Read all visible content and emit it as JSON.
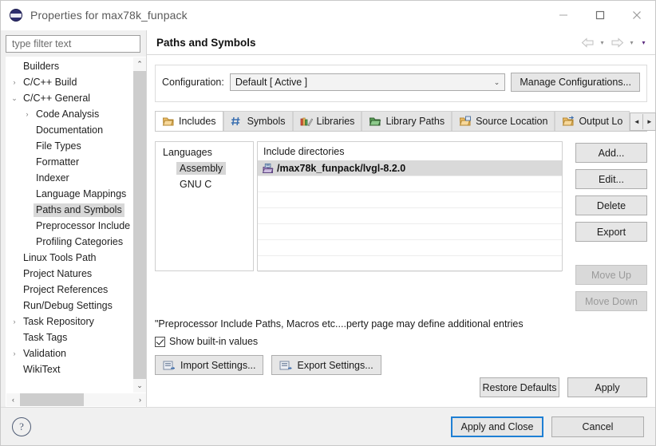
{
  "window": {
    "title": "Properties for max78k_funpack",
    "icon": "eclipse-ball-icon",
    "minimize": "—",
    "maximize": "□",
    "close": "✕"
  },
  "sidebar": {
    "filter": {
      "placeholder": "type filter text",
      "value": ""
    },
    "items": [
      {
        "label": "Builders",
        "level": 0,
        "twisty": "",
        "selected": false
      },
      {
        "label": "C/C++ Build",
        "level": 0,
        "twisty": "›",
        "selected": false
      },
      {
        "label": "C/C++ General",
        "level": 0,
        "twisty": "⌄",
        "selected": false
      },
      {
        "label": "Code Analysis",
        "level": 1,
        "twisty": "›",
        "selected": false
      },
      {
        "label": "Documentation",
        "level": 1,
        "twisty": "",
        "selected": false
      },
      {
        "label": "File Types",
        "level": 1,
        "twisty": "",
        "selected": false
      },
      {
        "label": "Formatter",
        "level": 1,
        "twisty": "",
        "selected": false
      },
      {
        "label": "Indexer",
        "level": 1,
        "twisty": "",
        "selected": false
      },
      {
        "label": "Language Mappings",
        "level": 1,
        "twisty": "",
        "selected": false
      },
      {
        "label": "Paths and Symbols",
        "level": 1,
        "twisty": "",
        "selected": true
      },
      {
        "label": "Preprocessor Include",
        "level": 1,
        "twisty": "",
        "selected": false
      },
      {
        "label": "Profiling Categories",
        "level": 1,
        "twisty": "",
        "selected": false
      },
      {
        "label": "Linux Tools Path",
        "level": 0,
        "twisty": "",
        "selected": false
      },
      {
        "label": "Project Natures",
        "level": 0,
        "twisty": "",
        "selected": false
      },
      {
        "label": "Project References",
        "level": 0,
        "twisty": "",
        "selected": false
      },
      {
        "label": "Run/Debug Settings",
        "level": 0,
        "twisty": "",
        "selected": false
      },
      {
        "label": "Task Repository",
        "level": 0,
        "twisty": "›",
        "selected": false
      },
      {
        "label": "Task Tags",
        "level": 0,
        "twisty": "",
        "selected": false
      },
      {
        "label": "Validation",
        "level": 0,
        "twisty": "›",
        "selected": false
      },
      {
        "label": "WikiText",
        "level": 0,
        "twisty": "",
        "selected": false
      }
    ],
    "scroll_up": "⌃",
    "scroll_down": "⌄",
    "scroll_left": "‹",
    "scroll_right": "›"
  },
  "page": {
    "title": "Paths and Symbols",
    "nav": {
      "back": "back-arrow",
      "forward": "forward-arrow",
      "caret": "▾"
    },
    "configuration": {
      "label": "Configuration:",
      "value": "Default  [ Active ]",
      "caret": "⌄",
      "manage_button": "Manage Configurations..."
    },
    "tabs": [
      {
        "label": "Includes",
        "icon": "includes-icon",
        "selected": true
      },
      {
        "label": "Symbols",
        "icon": "hash-icon",
        "selected": false
      },
      {
        "label": "Libraries",
        "icon": "libraries-icon",
        "selected": false
      },
      {
        "label": "Library Paths",
        "icon": "library-paths-icon",
        "selected": false
      },
      {
        "label": "Source Location",
        "icon": "source-location-icon",
        "selected": false
      },
      {
        "label": "Output Lo",
        "icon": "output-location-icon",
        "selected": false
      }
    ],
    "tab_scroll": {
      "left": "◄",
      "right": "►"
    },
    "languages": {
      "header": "Languages",
      "items": [
        {
          "label": "Assembly",
          "selected": true
        },
        {
          "label": "GNU C",
          "selected": false
        }
      ]
    },
    "include_directories": {
      "header": "Include directories",
      "rows": [
        {
          "path": "/max78k_funpack/lvgl-8.2.0",
          "icon": "include-folder-icon",
          "selected": true
        },
        {
          "path": "",
          "icon": "",
          "selected": false
        },
        {
          "path": "",
          "icon": "",
          "selected": false
        },
        {
          "path": "",
          "icon": "",
          "selected": false
        },
        {
          "path": "",
          "icon": "",
          "selected": false
        },
        {
          "path": "",
          "icon": "",
          "selected": false
        },
        {
          "path": "",
          "icon": "",
          "selected": false
        }
      ]
    },
    "side_buttons": [
      {
        "label": "Add...",
        "enabled": true
      },
      {
        "label": "Edit...",
        "enabled": true
      },
      {
        "label": "Delete",
        "enabled": true
      },
      {
        "label": "Export",
        "enabled": true
      },
      {
        "label": "Move Up",
        "enabled": false
      },
      {
        "label": "Move Down",
        "enabled": false
      }
    ],
    "note": "\"Preprocessor Include Paths, Macros etc....perty page may define additional entries",
    "show_builtin": {
      "label": "Show built-in values",
      "checked": true
    },
    "import_settings": "Import Settings...",
    "export_settings": "Export Settings...",
    "restore_defaults": "Restore Defaults",
    "apply": "Apply"
  },
  "footer": {
    "help": "?",
    "apply_and_close": "Apply and Close",
    "cancel": "Cancel"
  },
  "colors": {
    "accent_blue": "#1e7fd4",
    "selection_gray": "#d9d9d9",
    "folder_orange": "#e8a33d",
    "purple_icon": "#7b5ba6",
    "title_text": "#5a5a5a"
  }
}
